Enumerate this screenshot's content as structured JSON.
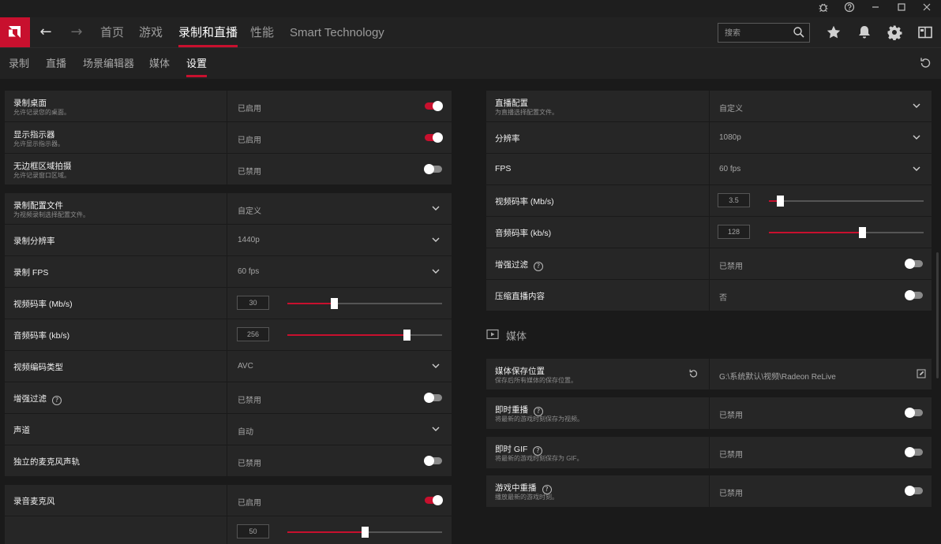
{
  "titlebar": {
    "bug_icon": "bug-icon",
    "help_icon": "help-icon",
    "minimize_icon": "minimize-icon",
    "maximize_icon": "maximize-icon",
    "close_icon": "close-icon"
  },
  "nav": {
    "logo": "amd-logo",
    "tabs": [
      "首页",
      "游戏",
      "录制和直播",
      "性能",
      "Smart Technology"
    ],
    "active_tab": "录制和直播",
    "search_placeholder": "搜索"
  },
  "subnav": {
    "tabs": [
      "录制",
      "直播",
      "场景编辑器",
      "媒体",
      "设置"
    ],
    "active_tab": "设置"
  },
  "accent_color": "#c8102e",
  "left": {
    "group1": [
      {
        "title": "录制桌面",
        "desc": "允许记录您的桌面。",
        "value": "已启用",
        "toggle": true
      },
      {
        "title": "显示指示器",
        "desc": "允许显示指示器。",
        "value": "已启用",
        "toggle": true
      },
      {
        "title": "无边框区域拍摄",
        "desc": "允许记录窗口区域。",
        "value": "已禁用",
        "toggle": false
      }
    ],
    "group2": [
      {
        "title": "录制配置文件",
        "desc": "为视频录制选择配置文件。",
        "value": "自定义"
      },
      {
        "title": "录制分辨率",
        "value": "1440p"
      },
      {
        "title": "录制 FPS",
        "value": "60 fps"
      },
      {
        "title": "视频码率 (Mb/s)",
        "value": "30",
        "level": 0.3
      },
      {
        "title": "音频码率 (kb/s)",
        "value": "256",
        "level": 0.77
      },
      {
        "title": "视频编码类型",
        "value": "AVC"
      },
      {
        "title": "增强过滤",
        "value": "已禁用",
        "toggle": false
      },
      {
        "title": "声道",
        "value": "自动"
      },
      {
        "title": "独立的麦克风声轨",
        "value": "已禁用",
        "toggle": false
      }
    ],
    "group3": [
      {
        "title": "录音麦克风",
        "value": "已启用",
        "toggle": true
      },
      {
        "title": "",
        "value": "50",
        "level": 0.5
      }
    ]
  },
  "right": {
    "group1": [
      {
        "title": "直播配置",
        "desc": "为直播选择配置文件。",
        "value": "自定义"
      },
      {
        "title": "分辨率",
        "value": "1080p"
      },
      {
        "title": "FPS",
        "value": "60 fps"
      },
      {
        "title": "视频码率 (Mb/s)",
        "value": "3.5",
        "level": 0.07
      },
      {
        "title": "音频码率 (kb/s)",
        "value": "128",
        "level": 0.6
      },
      {
        "title": "增强过滤",
        "value": "已禁用",
        "toggle": false
      },
      {
        "title": "压缩直播内容",
        "value": "否",
        "toggle": false
      }
    ],
    "media_section": "媒体",
    "group2": [
      {
        "title": "媒体保存位置",
        "desc": "保存后所有媒体的保存位置。",
        "value": "G:\\系统默认\\视频\\Radeon ReLive"
      },
      {
        "title": "即时重播",
        "desc": "将最新的游戏时刻保存为视频。",
        "value": "已禁用",
        "toggle": false
      },
      {
        "title": "即时 GIF",
        "desc": "将最新的游戏时刻保存为 GIF。",
        "value": "已禁用",
        "toggle": false
      },
      {
        "title": "游戏中重播",
        "desc": "播放最新的游戏时刻。",
        "value": "已禁用",
        "toggle": false
      }
    ]
  }
}
